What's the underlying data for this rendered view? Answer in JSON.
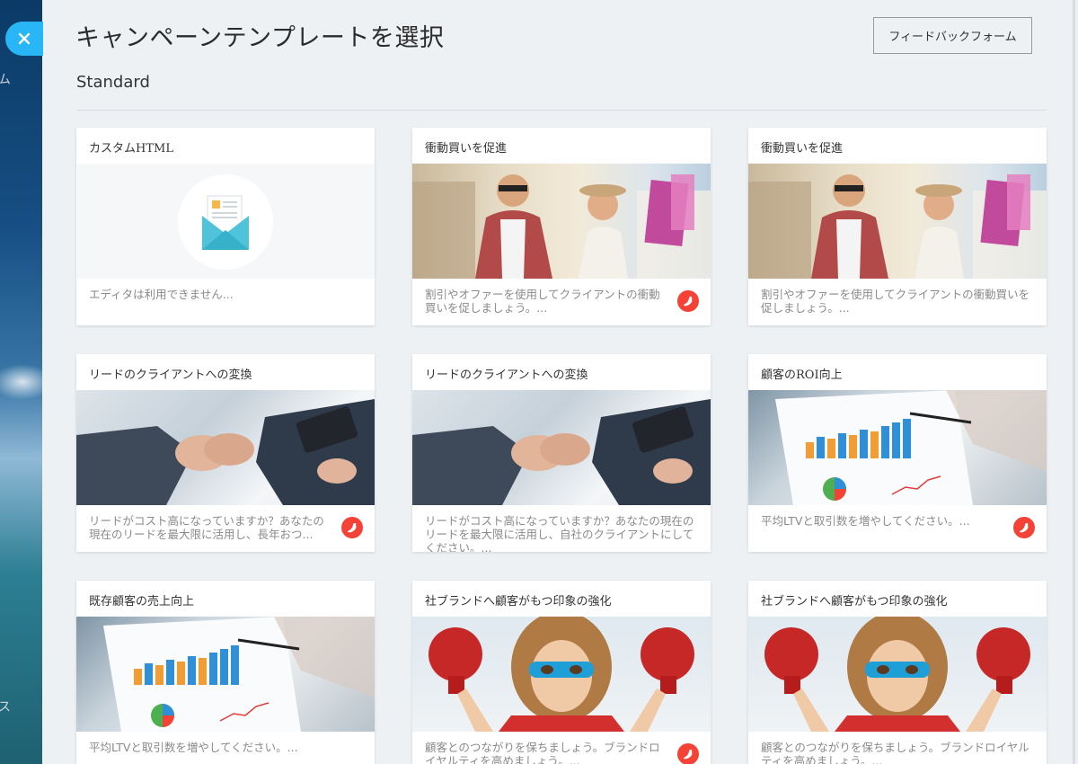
{
  "header": {
    "close_icon": "close-icon",
    "title": "キャンペーンテンプレートを選択",
    "feedback_button": "フィードバックフォーム"
  },
  "sidebar": {
    "frag1": "ム",
    "frag2": "ス"
  },
  "section": {
    "title": "Standard"
  },
  "colors": {
    "accent": "#29b6f6",
    "chili": "#f44336"
  },
  "cards": [
    {
      "title": "カスタムHTML",
      "description": "エディタは利用できません...",
      "image": "html-envelope-icon",
      "premium": false
    },
    {
      "title": "衝動買いを促進",
      "description": "割引やオファーを使用してクライアントの衝動買いを促しましょう。...",
      "image": "shopping-couple-image",
      "premium": true
    },
    {
      "title": "衝動買いを促進",
      "description": "割引やオファーを使用してクライアントの衝動買いを促しましょう。...",
      "image": "shopping-couple-image",
      "premium": false
    },
    {
      "title": "リードのクライアントへの変換",
      "description": "リードがコスト高になっていますか？あなたの現在のリードを最大限に活用し、長年おつ...",
      "image": "handshake-image",
      "premium": true
    },
    {
      "title": "リードのクライアントへの変換",
      "description": "リードがコスト高になっていますか？あなたの現在のリードを最大限に活用し、自社のクライアントにしてください。...",
      "image": "handshake-image",
      "premium": false
    },
    {
      "title": "顧客のROI向上",
      "description": "平均LTVと取引数を増やしてください。...",
      "image": "chart-paper-image",
      "premium": true
    },
    {
      "title": "既存顧客の売上向上",
      "description": "平均LTVと取引数を増やしてください。...",
      "image": "chart-paper-image",
      "premium": false
    },
    {
      "title": "社ブランドへ顧客がもつ印象の強化",
      "description": "顧客とのつながりを保ちましょう。ブランドロイヤルティを高めましょう。...",
      "image": "superhero-kid-image",
      "premium": true
    },
    {
      "title": "社ブランドへ顧客がもつ印象の強化",
      "description": "顧客とのつながりを保ちましょう。ブランドロイヤルティを高めましょう。...",
      "image": "superhero-kid-image",
      "premium": false
    }
  ]
}
